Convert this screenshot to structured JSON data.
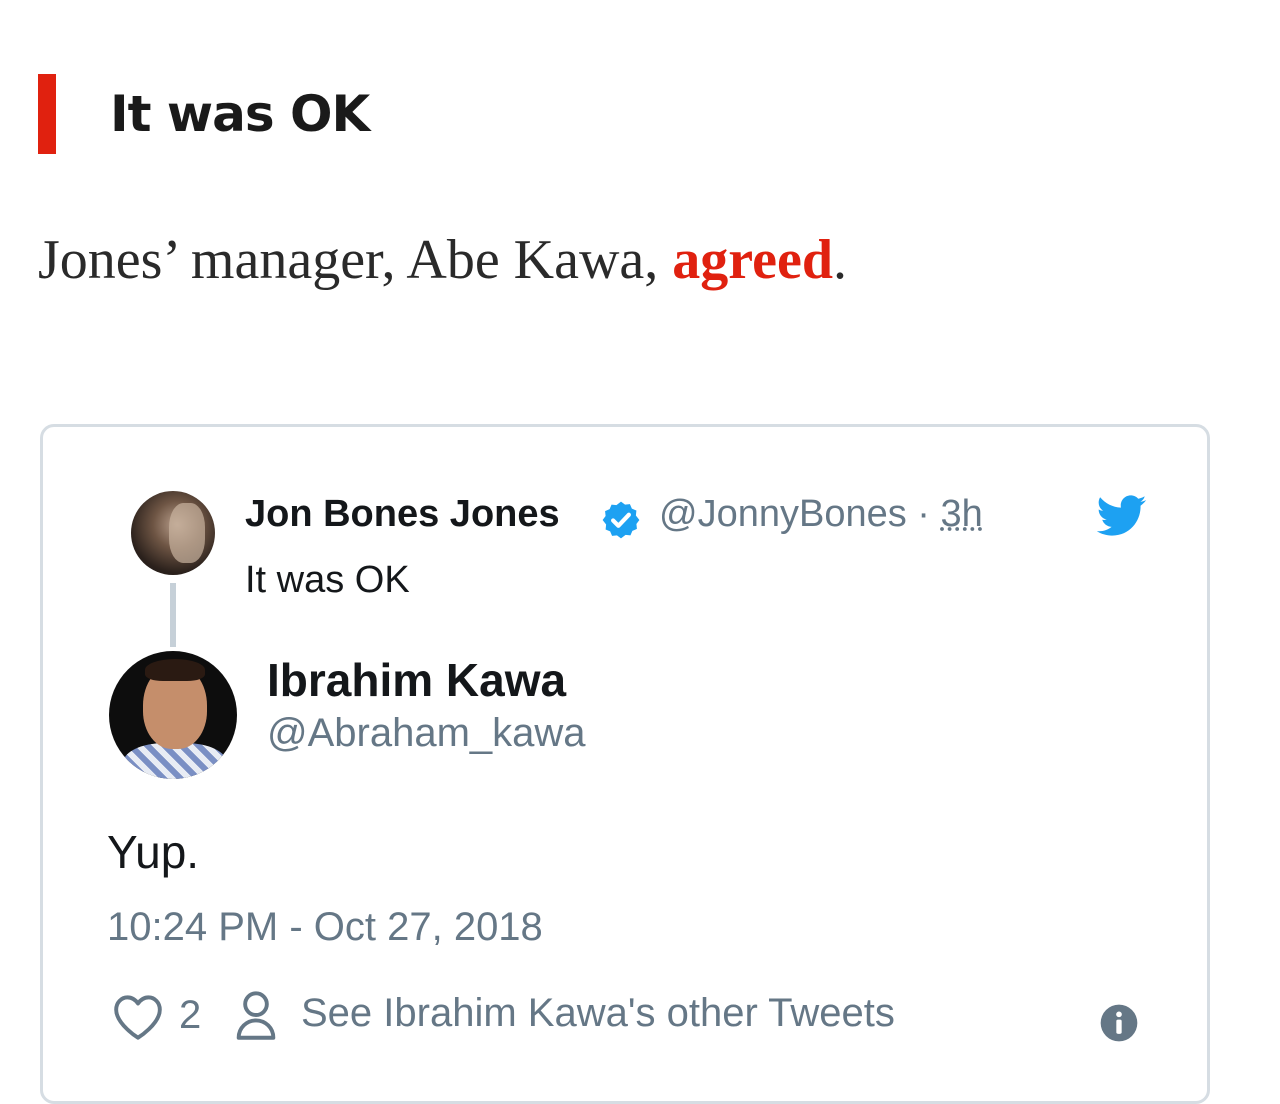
{
  "heading": {
    "text": "It was OK"
  },
  "paragraph": {
    "prefix": "Jones’ manager, Abe Kawa, ",
    "link_text": "agreed",
    "suffix": "."
  },
  "colors": {
    "accent_red": "#e0210f",
    "twitter_blue": "#1da1f2",
    "muted_gray": "#657786",
    "card_border": "#d6dde3"
  },
  "tweet": {
    "parent": {
      "name": "Jon Bones Jones",
      "handle": "@JonnyBones",
      "separator": " · ",
      "time": "3h",
      "text": "It was OK"
    },
    "author": {
      "name": "Ibrahim Kawa",
      "handle": "@Abraham_kawa"
    },
    "body": "Yup.",
    "timestamp": "10:24 PM - Oct 27, 2018",
    "likes": "2",
    "other_tweets_label": "See Ibrahim Kawa's other Tweets"
  },
  "icons": {
    "verified": "verified-badge-icon",
    "bird": "twitter-bird-icon",
    "heart": "heart-icon",
    "person": "person-icon",
    "info": "info-icon"
  }
}
